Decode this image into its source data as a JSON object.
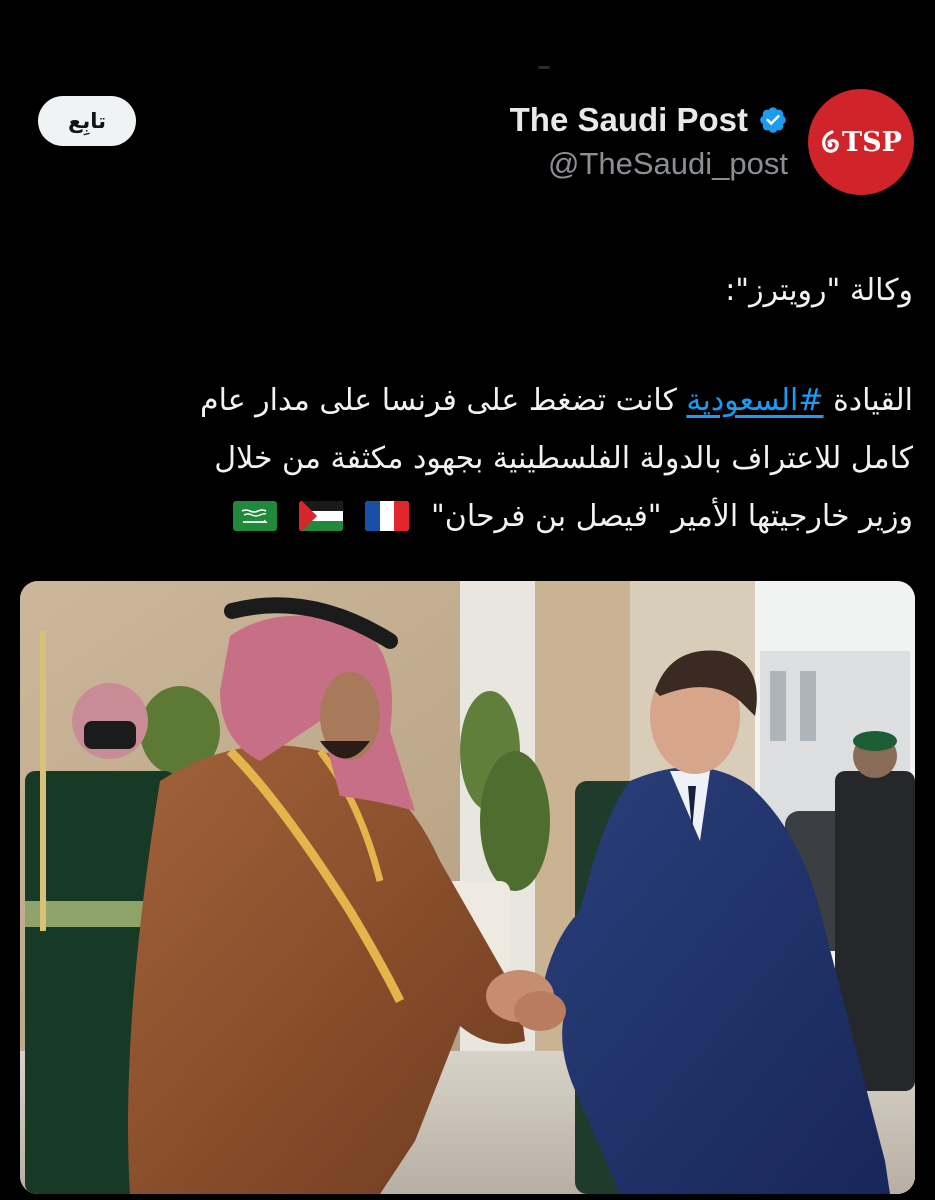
{
  "account": {
    "display_name": "The Saudi Post",
    "handle": "@TheSaudi_post",
    "avatar_text": "TSP",
    "avatar_color": "#d0232a",
    "verified_icon": "verified-badge-icon",
    "verified_color": "#1d9bf0"
  },
  "follow_button": {
    "label": "تابِع"
  },
  "tweet": {
    "line1": "وكالة \"رويترز\":",
    "line2_before": "القيادة ",
    "hashtag": "#السعودية",
    "line2_after": " كانت تضغط على فرنسا على مدار عام",
    "line3": "كامل للاعتراف بالدولة الفلسطينية بجهود مكثفة من خلال",
    "line4": "وزير خارجيتها الأمير \"فيصل بن فرحان\"",
    "flags": [
      "france-flag-icon",
      "palestine-flag-icon",
      "saudi-flag-icon"
    ]
  },
  "media": {
    "type": "photo",
    "icon": "photo-handshake"
  },
  "colors": {
    "background": "#000000",
    "text": "#e7e9ea",
    "secondary": "#8b8f94",
    "link": "#1d9bf0"
  }
}
